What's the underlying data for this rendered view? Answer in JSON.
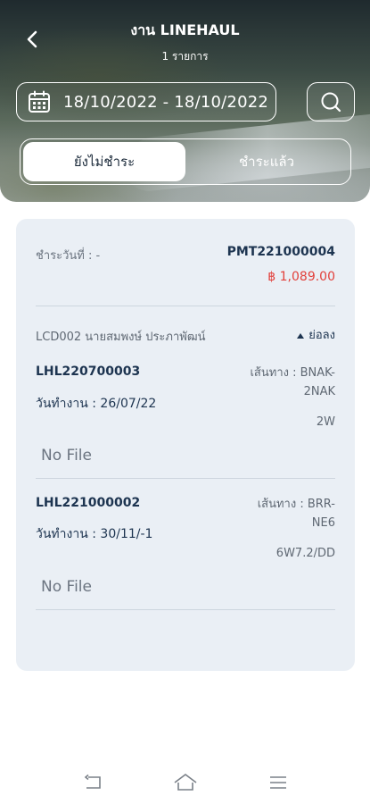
{
  "header": {
    "title": "งาน LINEHAUL",
    "subtitle": "1 รายการ",
    "date_range": "18/10/2022 - 18/10/2022"
  },
  "tabs": [
    {
      "label": "ยังไม่ชำระ",
      "active": true
    },
    {
      "label": "ชำระแล้ว",
      "active": false
    }
  ],
  "payment": {
    "pay_date_label": "ชำระวันที่ : -",
    "payment_id": "PMT221000004",
    "amount": "฿ 1,089.00",
    "driver": "LCD002 นายสมพงษ์ ประภาพัฒน์",
    "collapse_label": "ย่อลง",
    "jobs": [
      {
        "job_id": "LHL220700003",
        "work_date": "วันทำงาน : 26/07/22",
        "route_lines": [
          "เส้นทาง : BNAK-",
          "2NAK",
          "2W"
        ],
        "file_status": "No File"
      },
      {
        "job_id": "LHL221000002",
        "work_date": "วันทำงาน : 30/11/-1",
        "route_lines": [
          "เส้นทาง : BRR-",
          "NE6",
          "6W7.2/DD"
        ],
        "file_status": "No File"
      }
    ]
  },
  "icons": {
    "back": "chevron-left-icon",
    "calendar": "calendar-icon",
    "search": "search-icon",
    "collapse": "caret-up-icon",
    "nav_back": "nav-back-icon",
    "nav_home": "nav-home-icon",
    "nav_menu": "nav-menu-icon"
  },
  "colors": {
    "primary_text": "#1d3450",
    "amount_red": "#e2403b",
    "card_bg": "#eaeff5"
  }
}
